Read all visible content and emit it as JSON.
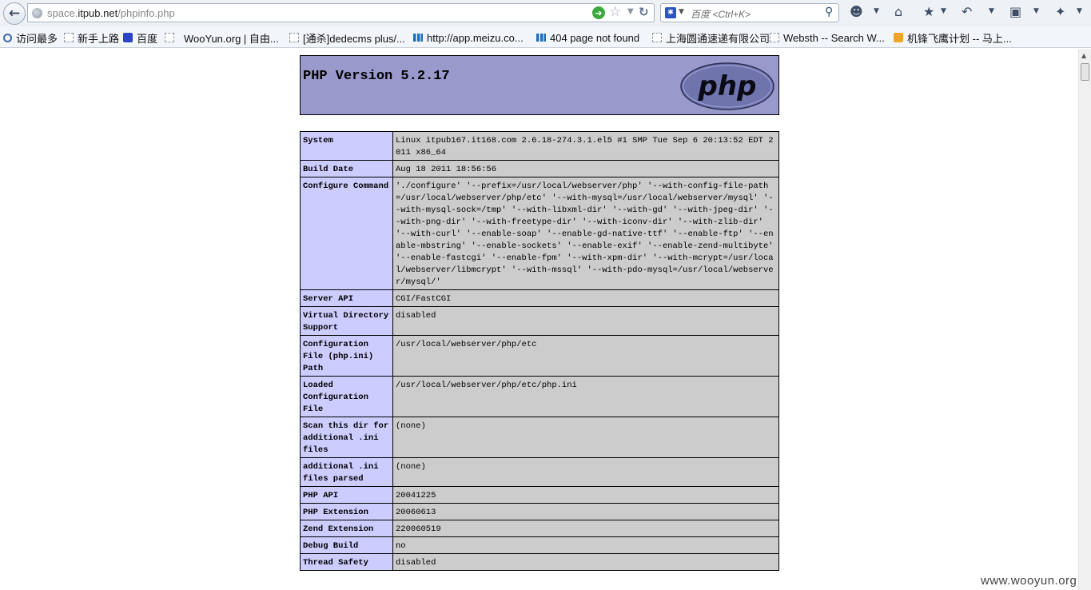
{
  "browser": {
    "url_prefix": "space.",
    "url_domain": "itpub.net",
    "url_path": "/phpinfo.php",
    "search_placeholder": "百度 <Ctrl+K>"
  },
  "bookmarks": [
    {
      "label": "访问最多",
      "icon": "search"
    },
    {
      "label": "新手上路",
      "icon": "blank"
    },
    {
      "label": "百度",
      "icon": "paw"
    },
    {
      "label": "WooYun.org | 自由...",
      "icon": "blank"
    },
    {
      "label": "[通杀]dedecms plus/...",
      "icon": "blank"
    },
    {
      "label": "http://app.meizu.co...",
      "icon": "blue"
    },
    {
      "label": "404 page not found",
      "icon": "blue"
    },
    {
      "label": "上海圆通速递有限公司",
      "icon": "blank"
    },
    {
      "label": "Websth -- Search W...",
      "icon": "blank"
    },
    {
      "label": "机锋飞鹰计划 -- 马上...",
      "icon": "orange"
    }
  ],
  "php": {
    "version_title": "PHP Version 5.2.17",
    "logo_text": "php"
  },
  "info_rows": [
    {
      "key": "System",
      "value": "Linux itpub167.it168.com 2.6.18-274.3.1.el5 #1 SMP Tue Sep 6 20:13:52 EDT 2011 x86_64"
    },
    {
      "key": "Build Date",
      "value": "Aug 18 2011 18:56:56"
    },
    {
      "key": "Configure Command",
      "value": "'./configure' '--prefix=/usr/local/webserver/php' '--with-config-file-path=/usr/local/webserver/php/etc' '--with-mysql=/usr/local/webserver/mysql' '--with-mysql-sock=/tmp' '--with-libxml-dir' '--with-gd' '--with-jpeg-dir' '--with-png-dir' '--with-freetype-dir' '--with-iconv-dir' '--with-zlib-dir' '--with-curl' '--enable-soap' '--enable-gd-native-ttf' '--enable-ftp' '--enable-mbstring' '--enable-sockets' '--enable-exif' '--enable-zend-multibyte' '--enable-fastcgi' '--enable-fpm' '--with-xpm-dir' '--with-mcrypt=/usr/local/webserver/libmcrypt' '--with-mssql' '--with-pdo-mysql=/usr/local/webserver/mysql/'"
    },
    {
      "key": "Server API",
      "value": "CGI/FastCGI"
    },
    {
      "key": "Virtual Directory Support",
      "value": "disabled"
    },
    {
      "key": "Configuration File (php.ini) Path",
      "value": "/usr/local/webserver/php/etc"
    },
    {
      "key": "Loaded Configuration File",
      "value": "/usr/local/webserver/php/etc/php.ini"
    },
    {
      "key": "Scan this dir for additional .ini files",
      "value": "(none)"
    },
    {
      "key": "additional .ini files parsed",
      "value": "(none)"
    },
    {
      "key": "PHP API",
      "value": "20041225"
    },
    {
      "key": "PHP Extension",
      "value": "20060613"
    },
    {
      "key": "Zend Extension",
      "value": "220060519"
    },
    {
      "key": "Debug Build",
      "value": "no"
    },
    {
      "key": "Thread Safety",
      "value": "disabled"
    }
  ],
  "watermark": "www.wooyun.org"
}
